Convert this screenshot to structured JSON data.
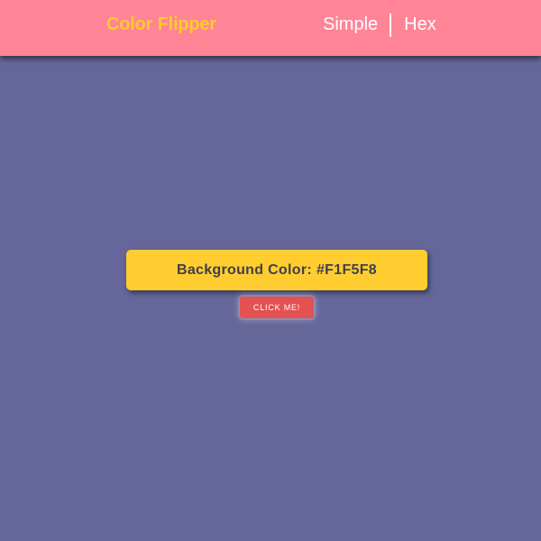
{
  "navbar": {
    "brand": "Color Flipper",
    "links": [
      {
        "label": "Simple"
      },
      {
        "label": "Hex"
      }
    ]
  },
  "main": {
    "color_label": "Background Color:",
    "color_value": "#F1F5F8",
    "button_label": "CLICK ME!"
  },
  "colors": {
    "background": "#656699",
    "navbar": "#ff8496",
    "brand": "#ffcb2d",
    "color_box": "#ffcd2f",
    "button": "#e35151"
  }
}
